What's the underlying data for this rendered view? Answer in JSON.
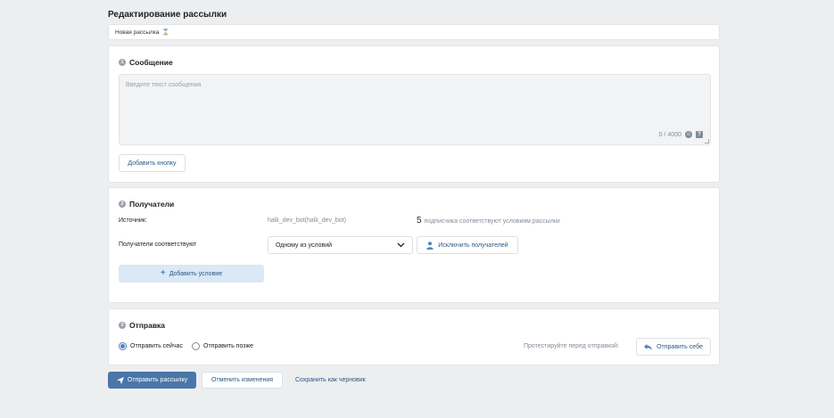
{
  "page": {
    "title": "Редактирование рассылки"
  },
  "name_bar": {
    "value": "Новая рассылка",
    "icon": "hourglass-icon"
  },
  "message": {
    "number": "1",
    "title": "Сообщение",
    "placeholder": "Введите текст сообщения",
    "counter": "0 / 4000",
    "emoji_icon": "smile-icon",
    "variable_icon": "variable-icon",
    "add_button_label": "Добавить кнопку"
  },
  "recipients": {
    "number": "2",
    "title": "Получатели",
    "source_label": "Источник:",
    "source_value": "halk_dev_bot(halk_dev_bot)",
    "match_count": "5",
    "match_text": "подписчика соответствуют условиям рассылки",
    "condition_label": "Получатели соответствуют",
    "condition_value": "Одному из условий",
    "exclude_label": "Исключить получателей",
    "add_condition_label": "Добавить условие"
  },
  "sending": {
    "number": "3",
    "title": "Отправка",
    "now_label": "Отправить сейчас",
    "later_label": "Отправить позже",
    "selected": "now",
    "test_label": "Протестируйте перед отправкой:",
    "self_send_label": "Отправить себе"
  },
  "footer": {
    "send_label": "Отправить рассылку",
    "cancel_label": "Отменить изменения",
    "draft_label": "Сохранить как черновик"
  },
  "colors": {
    "accent": "#4a76a8",
    "link": "#2a5885",
    "background": "#edeef0"
  }
}
